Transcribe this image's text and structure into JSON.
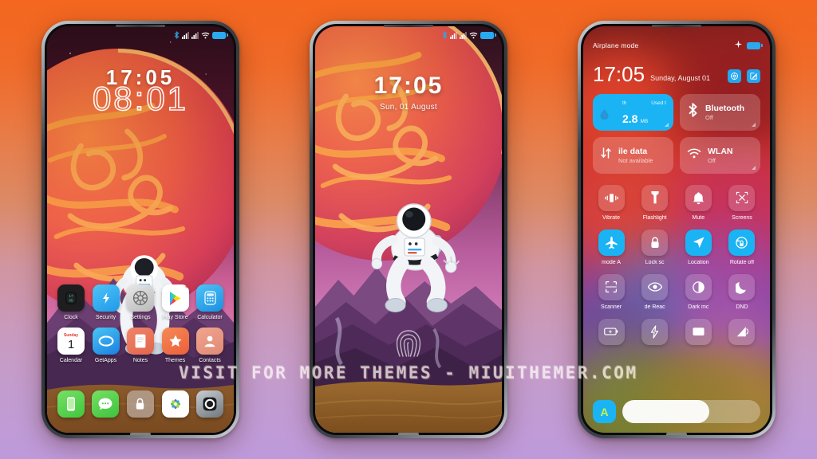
{
  "background": {
    "gradient_top": "#F4671F",
    "gradient_mid": "#D195A0",
    "gradient_bottom": "#BE9ADB"
  },
  "watermark": {
    "text": "VISIT FOR MORE THEMES - MIUITHEMER.COM"
  },
  "phone1": {
    "label": "Home screen",
    "statusbar": {
      "bluetooth": "bluetooth-icon",
      "signal1": "signal-icon",
      "signal2": "signal-icon",
      "wifi": "wifi-icon",
      "battery": "battery-icon"
    },
    "clock": {
      "time_bold": "17:05",
      "time_outline": "08:01"
    },
    "apps_row1": [
      {
        "label": "Clock",
        "icon": "clock-app-icon"
      },
      {
        "label": "Security",
        "icon": "security-app-icon"
      },
      {
        "label": "Settings",
        "icon": "settings-app-icon"
      },
      {
        "label": "Play Store",
        "icon": "play-store-app-icon",
        "badge": true
      },
      {
        "label": "Calculator",
        "icon": "calculator-app-icon"
      }
    ],
    "apps_row2": [
      {
        "label": "Calendar",
        "icon": "calendar-app-icon",
        "day_name": "Sunday",
        "day_num": "1"
      },
      {
        "label": "GetApps",
        "icon": "getapps-app-icon"
      },
      {
        "label": "Notes",
        "icon": "notes-app-icon"
      },
      {
        "label": "Themes",
        "icon": "themes-app-icon"
      },
      {
        "label": "Contacts",
        "icon": "contacts-app-icon"
      }
    ],
    "dock": [
      {
        "label": "Phone",
        "icon": "phone-dock-icon"
      },
      {
        "label": "Messages",
        "icon": "messages-dock-icon"
      },
      {
        "label": "App Lock",
        "icon": "lock-dock-icon"
      },
      {
        "label": "Gallery",
        "icon": "gallery-dock-icon"
      },
      {
        "label": "Camera",
        "icon": "camera-dock-icon"
      }
    ]
  },
  "phone2": {
    "label": "Lock screen",
    "statusbar": {
      "bluetooth": "bluetooth-icon",
      "signal1": "signal-icon",
      "signal2": "signal-icon",
      "wifi": "wifi-icon",
      "battery": "battery-icon"
    },
    "time": "17:05",
    "date": "Sun, 01 August",
    "fingerprint_icon": "fingerprint-icon"
  },
  "phone3": {
    "label": "Control center",
    "airplane_text": "Airplane mode",
    "statusbar": {
      "airplane": "airplane-icon",
      "battery": "battery-icon"
    },
    "time": "17:05",
    "date": "Sunday, August 01",
    "head_buttons": [
      {
        "name": "settings-shortcut",
        "icon": "gear-icon"
      },
      {
        "name": "edit-shortcut",
        "icon": "edit-icon"
      }
    ],
    "big_tiles": [
      {
        "name": "data-usage-tile",
        "state": "on",
        "top_left": "th",
        "top_right": "Used t",
        "value": "2.8",
        "unit": "MB",
        "icon": "data-drop-icon"
      },
      {
        "name": "bluetooth-tile",
        "state": "off",
        "title": "Bluetooth",
        "sub": "Off",
        "icon": "bluetooth-icon"
      },
      {
        "name": "mobile-data-tile",
        "state": "off",
        "title": "ile data",
        "sub": "Not available",
        "icon": "data-arrows-icon"
      },
      {
        "name": "wlan-tile",
        "state": "off",
        "title": "WLAN",
        "sub": "Off",
        "icon": "wifi-icon"
      }
    ],
    "toggles_row1": [
      {
        "label": "Vibrate",
        "icon": "vibrate-icon",
        "state": "off"
      },
      {
        "label": "Flashlight",
        "icon": "flashlight-icon",
        "state": "off"
      },
      {
        "label": "Mute",
        "icon": "bell-icon",
        "state": "off"
      },
      {
        "label": "Screens",
        "icon": "screenshot-icon",
        "state": "off"
      }
    ],
    "toggles_row2": [
      {
        "label": "mode   A",
        "icon": "airplane-icon",
        "state": "on"
      },
      {
        "label": "Lock sc",
        "icon": "lock-icon",
        "state": "off"
      },
      {
        "label": "Location",
        "icon": "location-icon",
        "state": "on"
      },
      {
        "label": "Rotate off",
        "icon": "rotate-icon",
        "state": "on"
      }
    ],
    "toggles_row3": [
      {
        "label": "Scanner",
        "icon": "scanner-icon",
        "state": "off"
      },
      {
        "label": "de   Reac",
        "icon": "reading-mode-icon",
        "state": "off"
      },
      {
        "label": "Dark mc",
        "icon": "dark-mode-icon",
        "state": "off"
      },
      {
        "label": "DND",
        "icon": "moon-icon",
        "state": "off"
      }
    ],
    "toggles_row4": [
      {
        "label": "",
        "icon": "battery-saver-icon",
        "state": "off"
      },
      {
        "label": "",
        "icon": "lightning-icon",
        "state": "off"
      },
      {
        "label": "",
        "icon": "cast-icon",
        "state": "off"
      },
      {
        "label": "",
        "icon": "cellular-icon",
        "state": "off"
      }
    ],
    "brightness": {
      "auto_label": "A",
      "fill_percent": 63
    }
  }
}
